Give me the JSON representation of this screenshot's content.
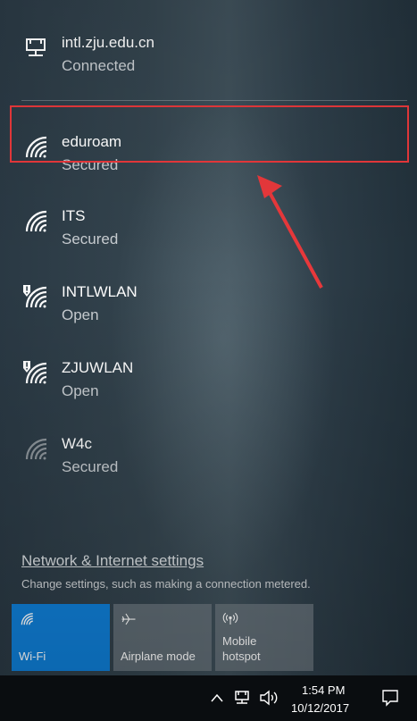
{
  "networks": [
    {
      "name": "intl.zju.edu.cn",
      "status": "Connected",
      "icon": "ethernet-icon"
    },
    {
      "name": "eduroam",
      "status": "Secured",
      "icon": "wifi-icon"
    },
    {
      "name": "ITS",
      "status": "Secured",
      "icon": "wifi-icon"
    },
    {
      "name": "INTLWLAN",
      "status": "Open",
      "icon": "wifi-shield-icon"
    },
    {
      "name": "ZJUWLAN",
      "status": "Open",
      "icon": "wifi-shield-icon"
    },
    {
      "name": "W4c",
      "status": "Secured",
      "icon": "wifi-weak-icon"
    }
  ],
  "settings": {
    "link": "Network & Internet settings",
    "description": "Change settings, such as making a connection metered."
  },
  "quick_actions": [
    {
      "label": "Wi-Fi",
      "icon": "wifi-icon",
      "active": true
    },
    {
      "label": "Airplane mode",
      "icon": "airplane-icon",
      "active": false
    },
    {
      "label": "Mobile\nhotspot",
      "icon": "hotspot-icon",
      "active": false
    }
  ],
  "taskbar": {
    "time": "1:54 PM",
    "date": "10/12/2017"
  },
  "colors": {
    "accent": "#0f7fd8",
    "highlight_box": "#e8383b"
  }
}
